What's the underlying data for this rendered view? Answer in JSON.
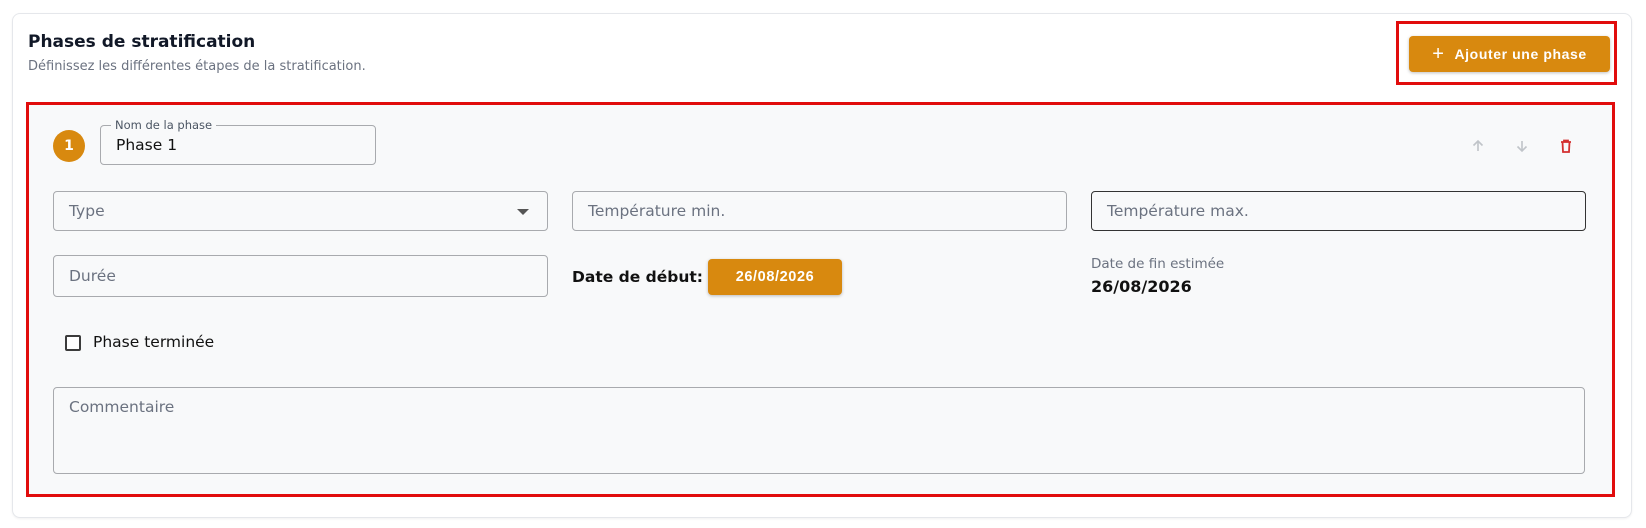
{
  "section": {
    "title": "Phases de stratification",
    "subtitle": "Définissez les différentes étapes de la stratification.",
    "add_button_label": "Ajouter une phase",
    "add_button_icon": "plus-icon"
  },
  "phase": {
    "number": "1",
    "name_legend": "Nom de la phase",
    "name_value": "Phase 1",
    "actions": [
      "arrow-up-icon",
      "arrow-down-icon",
      "trash-icon"
    ],
    "type_placeholder": "Type",
    "temp_min_placeholder": "Température min.",
    "temp_max_placeholder": "Température max.",
    "duration_placeholder": "Durée",
    "start_date_label": "Date de début:",
    "start_date_value": "26/08/2026",
    "end_date_label": "Date de fin estimée",
    "end_date_value": "26/08/2026",
    "completed_label": "Phase terminée",
    "completed_checked": false,
    "comment_placeholder": "Commentaire"
  },
  "colors": {
    "accent": "#d8890f",
    "highlight_border": "#e10c0c",
    "delete": "#d32f2f",
    "muted": "#6b7280"
  }
}
